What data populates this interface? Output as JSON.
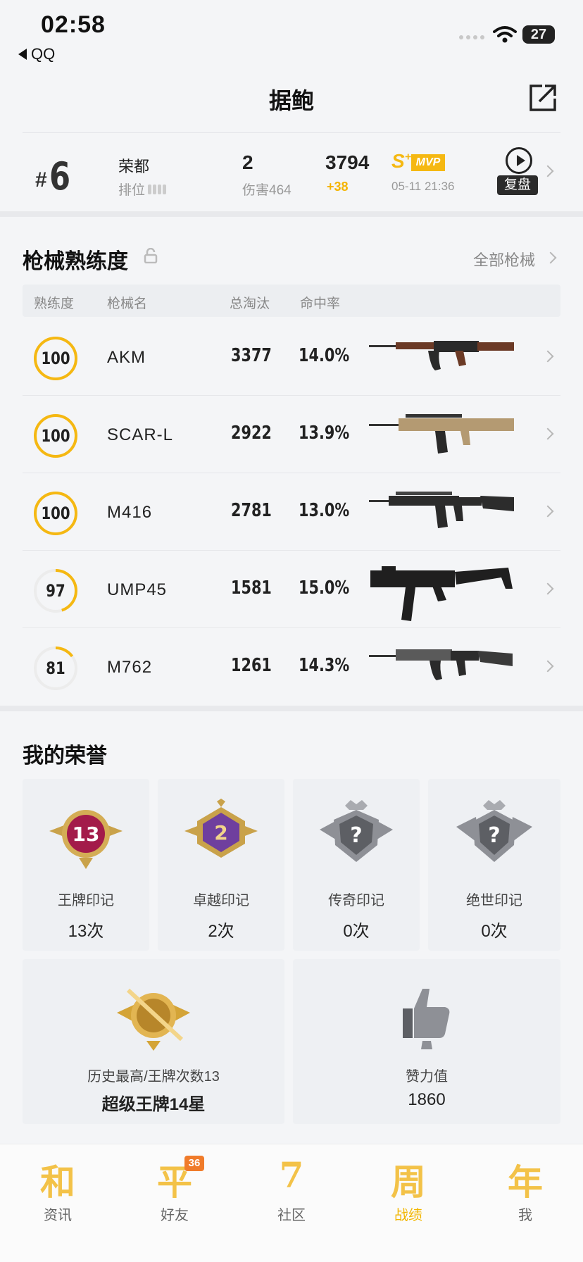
{
  "status_bar": {
    "time": "02:58",
    "back_app": "QQ",
    "battery": "27"
  },
  "header": {
    "title": "据鲍"
  },
  "match": {
    "rank_prefix": "#",
    "rank": "6",
    "map": "荣都",
    "mode": "排位",
    "kills": "2",
    "damage": "伤害464",
    "score": "3794",
    "score_delta": "+38",
    "grade": "S",
    "grade_sup": "+",
    "mvp": "MVP",
    "date": "05-11 21:36",
    "replay_label": "复盘"
  },
  "weapons": {
    "title": "枪械熟练度",
    "all_link": "全部枪械",
    "columns": [
      "熟练度",
      "枪械名",
      "总淘汰",
      "命中率"
    ],
    "rows": [
      {
        "mastery": "100",
        "mastery_pct": 1.0,
        "name": "AKM",
        "kills": "3377",
        "accuracy": "14.0%"
      },
      {
        "mastery": "100",
        "mastery_pct": 1.0,
        "name": "SCAR-L",
        "kills": "2922",
        "accuracy": "13.9%"
      },
      {
        "mastery": "100",
        "mastery_pct": 1.0,
        "name": "M416",
        "kills": "2781",
        "accuracy": "13.0%"
      },
      {
        "mastery": "97",
        "mastery_pct": 0.45,
        "name": "UMP45",
        "kills": "1581",
        "accuracy": "15.0%"
      },
      {
        "mastery": "81",
        "mastery_pct": 0.15,
        "name": "M762",
        "kills": "1261",
        "accuracy": "14.3%"
      }
    ]
  },
  "honors": {
    "title": "我的荣誉",
    "badges": [
      {
        "badge_text": "13",
        "label": "王牌印记",
        "count": "13次"
      },
      {
        "badge_text": "2",
        "label": "卓越印记",
        "count": "2次"
      },
      {
        "badge_text": "?",
        "label": "传奇印记",
        "count": "0次"
      },
      {
        "badge_text": "?",
        "label": "绝世印记",
        "count": "0次"
      }
    ],
    "highest": {
      "label": "历史最高/王牌次数13",
      "value": "超级王牌14星"
    },
    "likes": {
      "label": "赞力值",
      "value": "1860"
    }
  },
  "tabbar": {
    "tabs": [
      {
        "glyph": "和",
        "label": "资讯"
      },
      {
        "glyph": "平",
        "label": "好友",
        "badge": "36"
      },
      {
        "glyph": "7",
        "label": "社区"
      },
      {
        "glyph": "周",
        "label": "战绩"
      },
      {
        "glyph": "年",
        "label": "我"
      }
    ]
  },
  "colors": {
    "accent": "#f5b812",
    "ring_track": "#ececec",
    "silver": "#8e9096",
    "royal_purple": "#6f3f9e",
    "ace_red": "#a31b4a"
  }
}
